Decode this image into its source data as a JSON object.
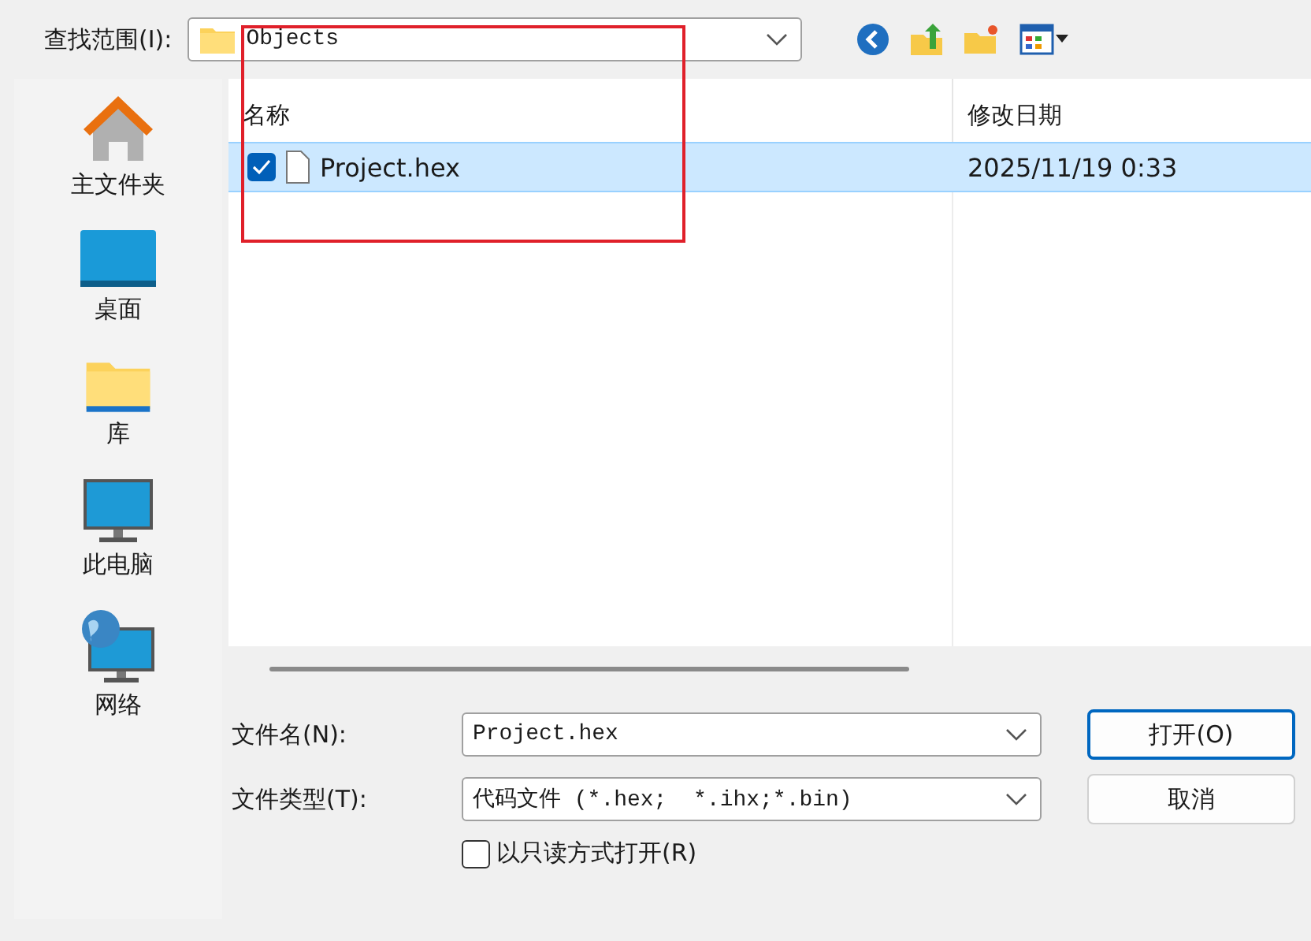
{
  "look_in": {
    "label": "查找范围(I):",
    "value": "Objects"
  },
  "sidebar": {
    "items": [
      {
        "label": "主文件夹",
        "kind": "home"
      },
      {
        "label": "桌面",
        "kind": "desktop"
      },
      {
        "label": "库",
        "kind": "folder"
      },
      {
        "label": "此电脑",
        "kind": "computer"
      },
      {
        "label": "网络",
        "kind": "network"
      }
    ]
  },
  "file_list": {
    "columns": [
      "名称",
      "修改日期"
    ],
    "rows": [
      {
        "name": "Project.hex",
        "modified": "2025/11/19 0:33",
        "selected": true,
        "checked": true
      }
    ]
  },
  "file_name": {
    "label": "文件名(N):",
    "value": "Project.hex"
  },
  "file_type": {
    "label": "文件类型(T):",
    "value": "代码文件 (*.hex;  *.ihx;*.bin)"
  },
  "read_only": {
    "label": "以只读方式打开(R)",
    "checked": false
  },
  "buttons": [
    {
      "label": "打开(O)",
      "default": true
    },
    {
      "label": "取消",
      "default": false
    }
  ]
}
